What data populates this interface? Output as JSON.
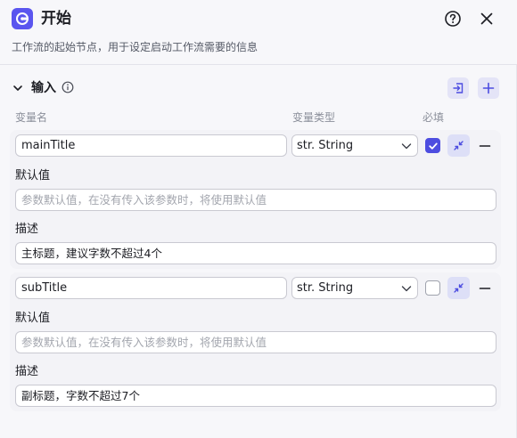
{
  "node": {
    "title": "开始",
    "description": "工作流的起始节点，用于设定启动工作流需要的信息"
  },
  "section": {
    "title": "输入"
  },
  "columns": {
    "name": "变量名",
    "type": "变量类型",
    "required": "必填"
  },
  "variables": [
    {
      "name": "mainTitle",
      "type": "str. String",
      "required": true,
      "default_label": "默认值",
      "default_placeholder": "参数默认值，在没有传入该参数时，将使用默认值",
      "default_value": "",
      "desc_label": "描述",
      "desc_value": "主标题，建议字数不超过4个"
    },
    {
      "name": "subTitle",
      "type": "str. String",
      "required": false,
      "default_label": "默认值",
      "default_placeholder": "参数默认值，在没有传入该参数时，将使用默认值",
      "default_value": "",
      "desc_label": "描述",
      "desc_value": "副标题，字数不超过7个"
    }
  ],
  "icons": {
    "node": "start-node-icon",
    "help": "question-circle-icon",
    "close": "close-icon",
    "collapse_section": "chevron-down-icon",
    "info": "info-circle-icon",
    "import": "import-icon",
    "add": "plus-icon",
    "collapse_row": "collapse-arrows-icon",
    "remove": "minus-icon"
  },
  "colors": {
    "accent": "#4d4de0",
    "node_icon_bg": "#5a55ef",
    "button_bg": "#e4e4f7",
    "panel_bg": "#f7f7fa"
  }
}
